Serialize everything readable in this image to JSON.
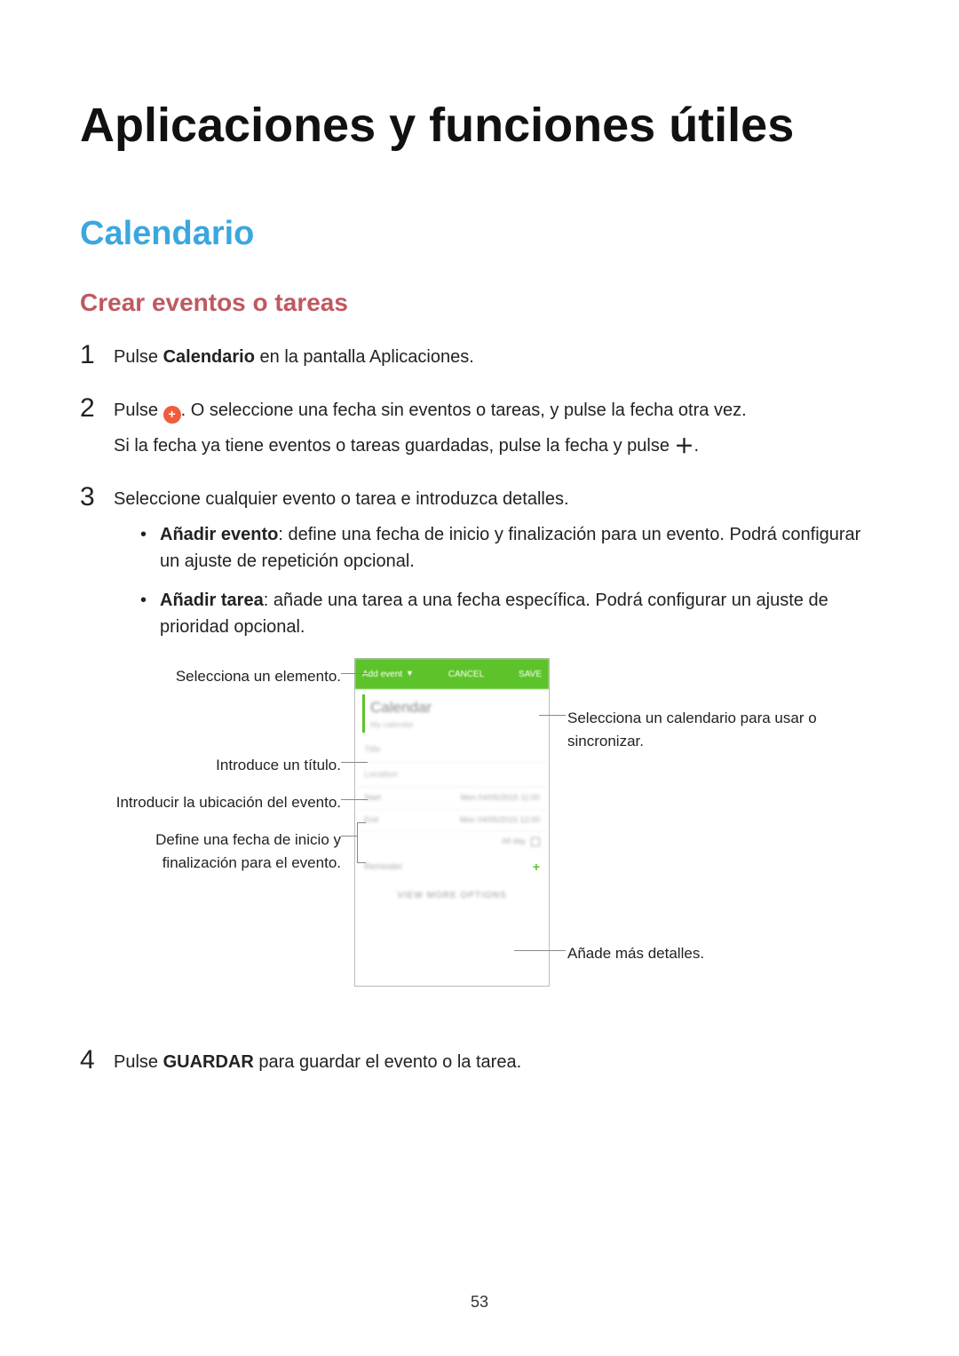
{
  "title": "Aplicaciones y funciones útiles",
  "section": "Calendario",
  "subsection": "Crear eventos o tareas",
  "steps": {
    "s1": {
      "num": "1",
      "pre": "Pulse ",
      "bold": "Calendario",
      "post": " en la pantalla Aplicaciones."
    },
    "s2": {
      "num": "2",
      "line1_pre": "Pulse ",
      "line1_post": ". O seleccione una fecha sin eventos o tareas, y pulse la fecha otra vez.",
      "line2_pre": "Si la fecha ya tiene eventos o tareas guardadas, pulse la fecha y pulse ",
      "line2_post": "."
    },
    "s3": {
      "num": "3",
      "intro": "Seleccione cualquier evento o tarea e introduzca detalles.",
      "b1_bold": "Añadir evento",
      "b1_text": ": define una fecha de inicio y finalización para un evento. Podrá configurar un ajuste de repetición opcional.",
      "b2_bold": "Añadir tarea",
      "b2_text": ": añade una tarea a una fecha específica. Podrá configurar un ajuste de prioridad opcional."
    },
    "s4": {
      "num": "4",
      "pre": "Pulse ",
      "bold": "GUARDAR",
      "post": " para guardar el evento o la tarea."
    }
  },
  "callouts": {
    "c1": "Selecciona un elemento.",
    "c2": "Selecciona un calendario para usar o sincronizar.",
    "c3": "Introduce un título.",
    "c4": "Introducir la ubicación del evento.",
    "c5a": "Define una fecha de inicio y",
    "c5b": "finalización para el evento.",
    "c6": "Añade más detalles."
  },
  "phone": {
    "add_event": "Add event",
    "cancel": "CANCEL",
    "save": "SAVE",
    "cal_line1": "Calendar",
    "cal_line2": "My calendar",
    "title_placeholder": "Title",
    "location_placeholder": "Location",
    "start": "Start",
    "start_val": "Mon 04/05/2015   11:00",
    "end": "End",
    "end_val": "Mon 04/05/2015   12:00",
    "allday": "All day",
    "reminder": "Reminder",
    "view_more": "VIEW MORE OPTIONS"
  },
  "page_number": "53"
}
